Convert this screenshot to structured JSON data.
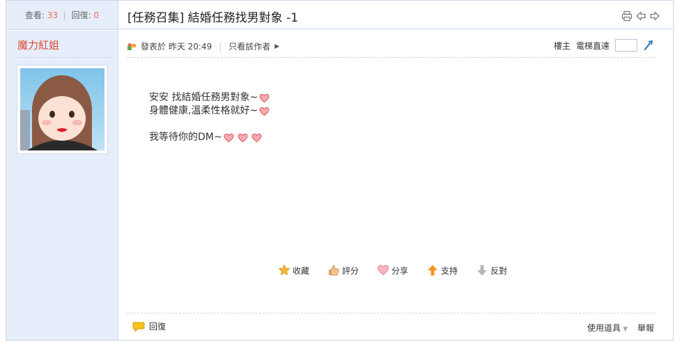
{
  "stats": {
    "views_label": "查看:",
    "views": "33",
    "replies_label": "回復:",
    "replies": "0"
  },
  "thread": {
    "title": "[任務召集] 結婚任務找男對象 -1",
    "icons": [
      "print-icon",
      "prev-thread-icon",
      "next-thread-icon"
    ]
  },
  "author": {
    "name": "魔力紅姐"
  },
  "post_meta": {
    "posted_on": "發表於 昨天 20:49",
    "only_author": "只看該作者",
    "floor_label": "樓主",
    "jump_label": "電梯直達"
  },
  "message": {
    "line1": "安安 找結婚任務男對象~",
    "line2": "身體健康,溫柔性格就好~",
    "line3": "我等待你的DM~"
  },
  "actions": {
    "favorite": "收藏",
    "rate": "評分",
    "share": "分享",
    "support": "支持",
    "oppose": "反對"
  },
  "footer": {
    "reply": "回復",
    "use_tools": "使用道具",
    "report": "舉報"
  },
  "colors": {
    "accent_red": "#e0492f",
    "side_bg": "#e6edfb",
    "border": "#cdd5e4",
    "count_orange": "#f26c4f"
  }
}
